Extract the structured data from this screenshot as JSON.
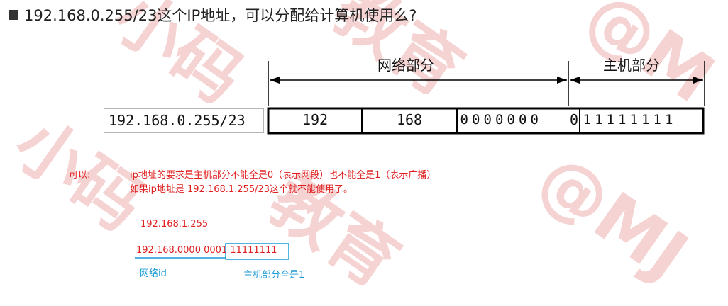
{
  "title": "192.168.0.255/23这个IP地址，可以分配给计算机使用么?",
  "diagram": {
    "network_part_label": "网络部分",
    "host_part_label": "主机部分",
    "cidr": "192.168.0.255/23",
    "octet1": "192",
    "octet2": "168",
    "octet3_net_bits": [
      "0",
      "0",
      "0",
      "0",
      "0",
      "0",
      "0"
    ],
    "octet3_host_bit": "0",
    "octet4_bits": [
      "1",
      "1",
      "1",
      "1",
      "1",
      "1",
      "1",
      "1"
    ]
  },
  "note": {
    "label": "可以:",
    "line1": "ip地址的要求是主机部分不能全是0（表示网段）也不能全是1（表示广播）",
    "line2": "如果ip地址是 192.168.1.255/23这个就不能使用了。"
  },
  "example": {
    "ip": "192.168.1.255",
    "binary_network": "192.168.0000 000",
    "binary_host": "1 11111111",
    "network_id_label": "网络id",
    "host_all_ones_label": "主机部分全是1"
  },
  "colors": {
    "red": "#e02020",
    "blue": "#1a9ad6"
  }
}
